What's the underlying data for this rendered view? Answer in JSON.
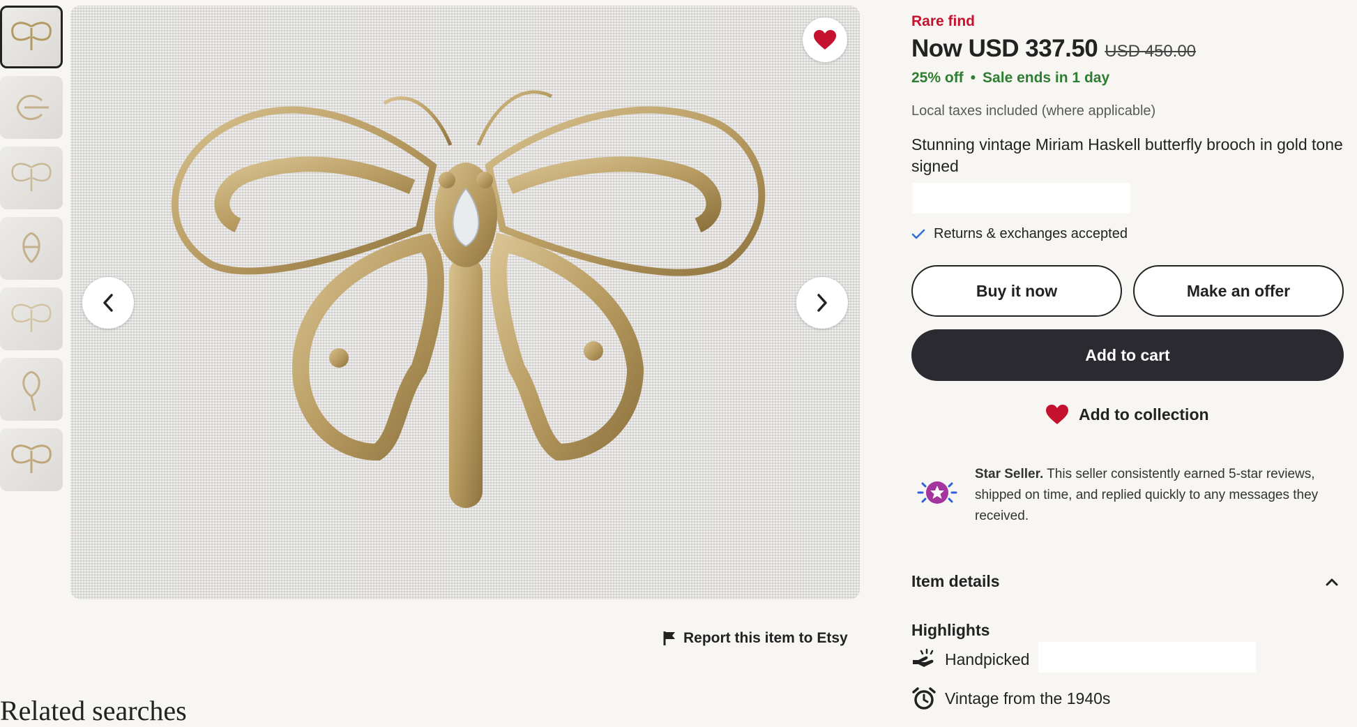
{
  "listing": {
    "rare_label": "Rare find",
    "price_now": "Now USD 337.50",
    "price_original": "USD 450.00",
    "discount": "25% off",
    "sale_separator": "•",
    "sale_ends": "Sale ends in 1 day",
    "tax_note": "Local taxes included (where applicable)",
    "title": "Stunning vintage Miriam Haskell butterfly brooch in gold tone signed",
    "returns": "Returns & exchanges accepted"
  },
  "actions": {
    "buy_now": "Buy it now",
    "make_offer": "Make an offer",
    "add_to_cart": "Add to cart",
    "add_to_collection": "Add to collection",
    "report": "Report this item to Etsy"
  },
  "star_seller": {
    "label": "Star Seller.",
    "description": "This seller consistently earned 5-star reviews, shipped on time, and replied quickly to any messages they received."
  },
  "details": {
    "item_details": "Item details",
    "highlights": "Highlights",
    "handpicked": "Handpicked",
    "vintage": "Vintage from the 1940s"
  },
  "related": {
    "heading": "Related searches"
  },
  "gallery": {
    "thumbnail_count": 7,
    "active_index": 0
  },
  "colors": {
    "rare": "#c4122f",
    "sale": "#2f7d32",
    "cart_button": "#2c2a31",
    "heart": "#c4122f",
    "star_badge": "#a3359e",
    "check": "#2f6fd6"
  },
  "icons": {
    "favorite": "heart-icon",
    "prev": "chevron-left-icon",
    "next": "chevron-right-icon",
    "report": "flag-icon",
    "returns": "checkmark-icon",
    "collection": "heart-icon",
    "star_seller": "star-badge-icon",
    "item_details_toggle": "chevron-up-icon",
    "handpicked": "hand-sparkle-icon",
    "vintage": "alarm-clock-icon"
  }
}
